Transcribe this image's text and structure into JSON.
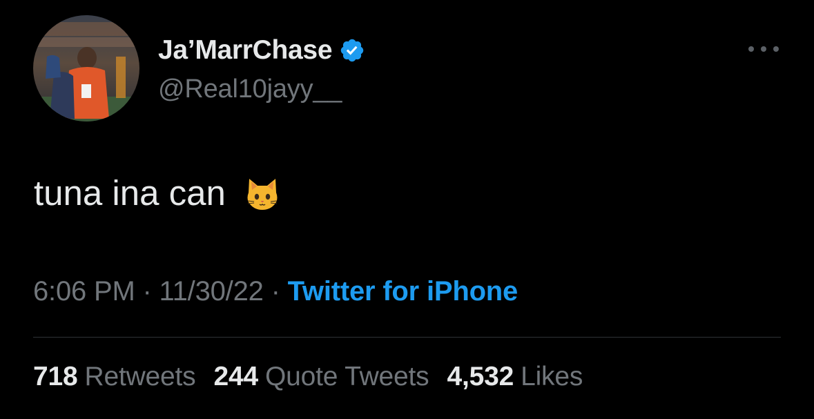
{
  "author": {
    "display_name": "Ja’MarrChase",
    "handle": "@Real10jayy__",
    "verified": true,
    "avatar_icon": "avatar-photo"
  },
  "tweet": {
    "text": "tuna ina can",
    "emoji": "cat-face",
    "time": "6:06 PM",
    "date": "11/30/22",
    "source": "Twitter for iPhone",
    "separator": "·"
  },
  "stats": {
    "retweets_count": "718",
    "retweets_label": "Retweets",
    "quotes_count": "244",
    "quotes_label": "Quote Tweets",
    "likes_count": "4,532",
    "likes_label": "Likes"
  },
  "colors": {
    "background": "#000000",
    "text_primary": "#e7e9ea",
    "text_secondary": "#71767b",
    "accent": "#1d9bf0",
    "divider": "#2f3336"
  }
}
